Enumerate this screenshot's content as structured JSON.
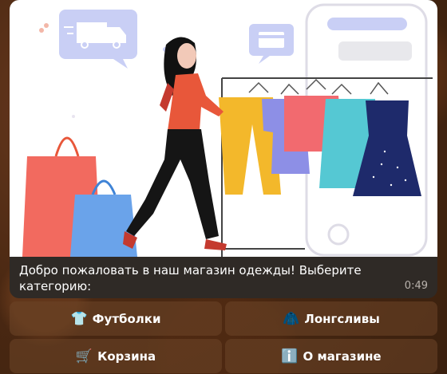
{
  "message": {
    "caption": "Добро пожаловать в наш магазин одежды! Выберите категорию:",
    "time": "0:49"
  },
  "keyboard": {
    "rows": [
      [
        {
          "emoji": "👕",
          "label": "Футболки"
        },
        {
          "emoji": "🧥",
          "label": "Лонгсливы"
        }
      ],
      [
        {
          "emoji": "🛒",
          "label": "Корзина"
        },
        {
          "emoji": "ℹ️",
          "label": "О магазине"
        }
      ]
    ]
  },
  "colors": {
    "bubble": "#2f2a26",
    "accent_orange": "#e8573a",
    "accent_blue": "#6a9ff0",
    "illustration_lavender": "#c9cff5"
  }
}
